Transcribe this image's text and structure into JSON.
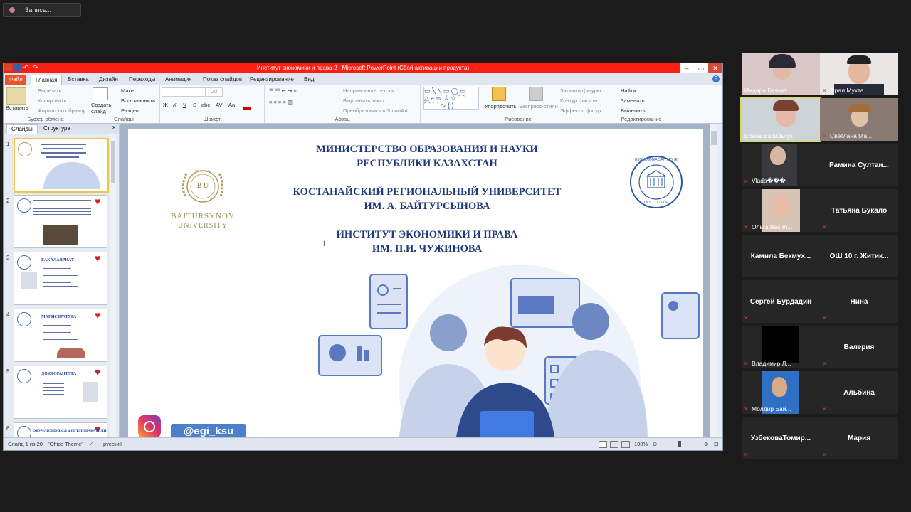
{
  "recording": {
    "label": "Запись..."
  },
  "ppt": {
    "window_title": "Институт экономики и права-2 - Microsoft PowerPoint (Сбой активации продукта)",
    "tabs": [
      "Файл",
      "Главная",
      "Вставка",
      "Дизайн",
      "Переходы",
      "Анимация",
      "Показ слайдов",
      "Рецензирование",
      "Вид"
    ],
    "ribbon": {
      "clipboard": {
        "paste": "Вставить",
        "cut": "Вырезать",
        "copy": "Копировать",
        "format_painter": "Формат по образцу",
        "group": "Буфер обмена"
      },
      "slides": {
        "new_slide": "Создать слайд",
        "layout": "Макет",
        "reset": "Восстановить",
        "section": "Раздел",
        "group": "Слайды"
      },
      "font": {
        "group": "Шрифт",
        "size": "20",
        "bold": "Ж",
        "italic": "К",
        "underline": "Ч",
        "shadow": "S",
        "strike": "abc",
        "spacing": "AV",
        "case": "Aa"
      },
      "paragraph": {
        "group": "Абзац",
        "text_direction": "Направление текста",
        "align_text": "Выровнять текст",
        "smartart": "Преобразовать в SmartArt"
      },
      "drawing": {
        "arrange": "Упорядочить",
        "quick_styles": "Экспресс-стили",
        "fill": "Заливка фигуры",
        "outline": "Контур фигуры",
        "effects": "Эффекты фигур",
        "group": "Рисование"
      },
      "editing": {
        "find": "Найти",
        "replace": "Заменить",
        "select": "Выделить",
        "group": "Редактирование"
      }
    },
    "panel": {
      "tab_slides": "Слайды",
      "tab_outline": "Структура",
      "close": "×"
    },
    "thumbs": [
      {
        "num": "1",
        "title": ""
      },
      {
        "num": "2",
        "title": ""
      },
      {
        "num": "3",
        "title": "БАКАЛАВРИАТ"
      },
      {
        "num": "4",
        "title": "МАГИСТРАТУРА"
      },
      {
        "num": "5",
        "title": "ДОКТОРАНТУРА"
      },
      {
        "num": "6",
        "title": "ОБУЧАЮЩИЕСЯ и ПРЕПОДАВАТЕЛИ"
      }
    ],
    "slide": {
      "line1": "МИНИСТЕРСТВО ОБРАЗОВАНИЯ И НАУКИ",
      "line2": "РЕСПУБЛИКИ КАЗАХСТАН",
      "line3": "КОСТАНАЙСКИЙ РЕГИОНАЛЬНЫЙ УНИВЕРСИТЕТ",
      "line4": "ИМ. А. БАЙТУРСЫНОВА",
      "line5": "ИНСТИТУТ ЭКОНОМИКИ И ПРАВА",
      "line6": "ИМ. П.И. ЧУЖИНОВА",
      "logo_left_name": "BAITURSYNOV",
      "logo_left_sub": "UNIVERSITY",
      "logo_left_since": "SINCE 1939",
      "logo_left_letters": "B U",
      "seal_top": "ЕКОНОМИКА ЗАҢ ЖӘНЕ",
      "seal_bottom": "INSTITUTE",
      "instagram_handle": "@egi_ksu"
    },
    "status": {
      "slide_info": "Слайд 1 из 20",
      "theme": "\"Office Theme\"",
      "language": "русский",
      "zoom": "100%"
    }
  },
  "participants": [
    {
      "name": "Индира Баязит...",
      "video": true,
      "muted": false
    },
    {
      "name": "Орал Мухта...",
      "video": true,
      "muted": true
    },
    {
      "name": "Елена Васильчук",
      "video": true,
      "muted": false,
      "active_speaker": true
    },
    {
      "name": "Светлана Ма...",
      "video": true,
      "muted": true
    },
    {
      "name": "Vlada���",
      "video": true,
      "muted": true
    },
    {
      "name": "Рамина  Султан...",
      "video": false,
      "muted": false
    },
    {
      "name": "Ольга Васил...",
      "video": true,
      "muted": true
    },
    {
      "name": "Татьяна Букало",
      "video": false,
      "muted": true
    },
    {
      "name": "Камила  Бекмух...",
      "video": false,
      "muted": false
    },
    {
      "name": "ОШ 10 г. Житик...",
      "video": false,
      "muted": false
    },
    {
      "name": "Сергей Бурдадин",
      "video": false,
      "muted": true
    },
    {
      "name": "Нина",
      "video": false,
      "muted": true
    },
    {
      "name": "Владимир Л...",
      "video": true,
      "muted": true
    },
    {
      "name": "Валерия",
      "video": false,
      "muted": true
    },
    {
      "name": "Молдир Бай...",
      "video": true,
      "muted": true
    },
    {
      "name": "Альбина",
      "video": false,
      "muted": true
    },
    {
      "name": "УзбековаТомир...",
      "video": false,
      "muted": true
    },
    {
      "name": "Мария",
      "video": false,
      "muted": true
    }
  ],
  "colors": {
    "ppt_title_bar": "#ff1e12",
    "slide_title": "#1f3a7a",
    "active_speaker_outline": "#d7dd4a",
    "heart": "#d81e2a"
  }
}
